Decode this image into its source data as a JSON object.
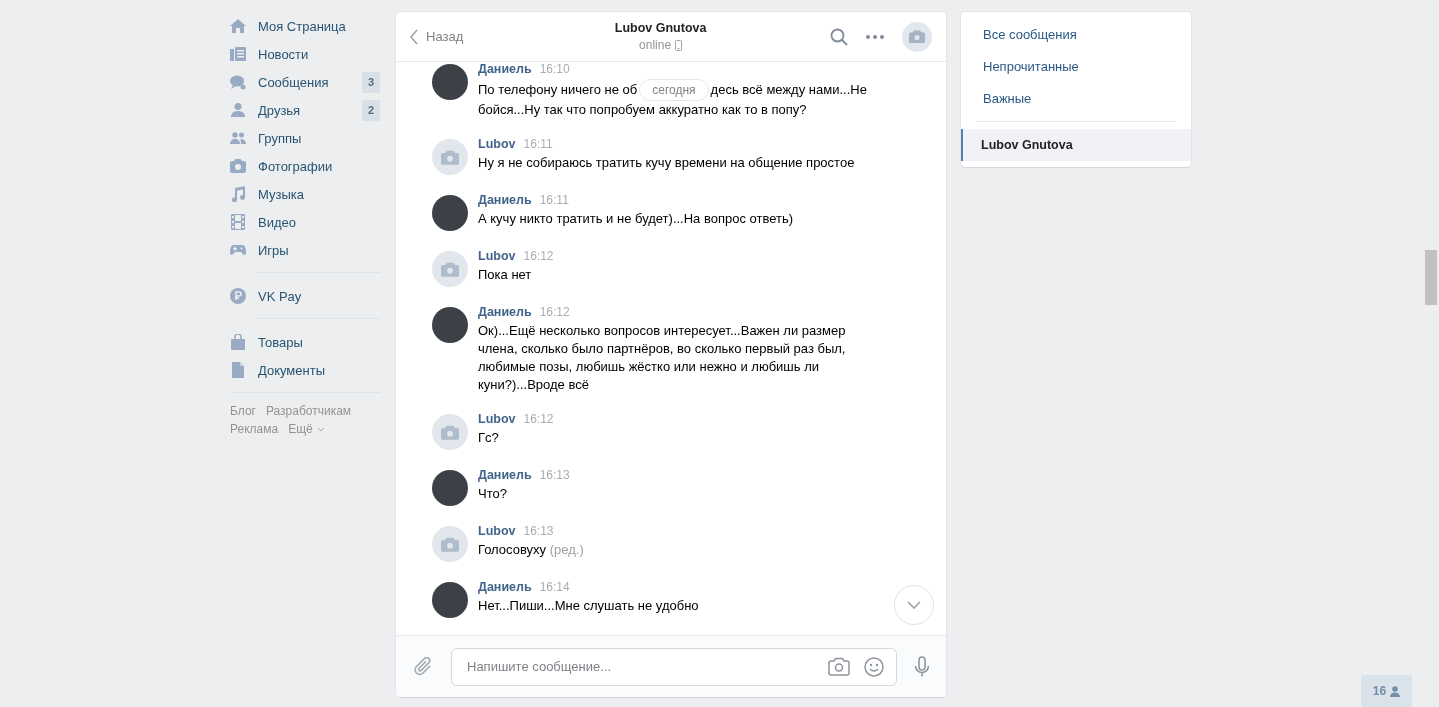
{
  "nav": {
    "sections": [
      [
        {
          "label": "Моя Страница",
          "kind": "home"
        },
        {
          "label": "Новости",
          "kind": "news"
        },
        {
          "label": "Сообщения",
          "kind": "messages",
          "badge": "3"
        },
        {
          "label": "Друзья",
          "kind": "person",
          "badge": "2"
        },
        {
          "label": "Группы",
          "kind": "people"
        },
        {
          "label": "Фотографии",
          "kind": "camera"
        },
        {
          "label": "Музыка",
          "kind": "music"
        },
        {
          "label": "Видео",
          "kind": "video"
        },
        {
          "label": "Игры",
          "kind": "games"
        }
      ],
      [
        {
          "label": "VK Pay",
          "kind": "pay"
        }
      ],
      [
        {
          "label": "Товары",
          "kind": "bag"
        },
        {
          "label": "Документы",
          "kind": "doc"
        }
      ]
    ],
    "footer_links": [
      "Блог",
      "Разработчикам",
      "Реклама",
      "Ещё"
    ]
  },
  "chat": {
    "header": {
      "back": "Назад",
      "title": "Lubov Gnutova",
      "status": "online"
    },
    "date_label": "сегодня",
    "messages": [
      {
        "author": "Даниель",
        "time": "16:10",
        "kind": "photo",
        "text_parts": [
          "По телефону ничего не об",
          "десь всё между нами...Не",
          "бойся...Ну так что попробуем аккуратно как то в попу?"
        ]
      },
      {
        "author": "Lubov",
        "time": "16:11",
        "kind": "placeholder",
        "text_parts": [
          "Ну я не собираюсь тратить кучу времени на общение простое"
        ]
      },
      {
        "author": "Даниель",
        "time": "16:11",
        "kind": "photo",
        "text_parts": [
          "А кучу никто тратить и не будет)...На вопрос ответь)"
        ]
      },
      {
        "author": "Lubov",
        "time": "16:12",
        "kind": "placeholder",
        "text_parts": [
          "Пока нет"
        ]
      },
      {
        "author": "Даниель",
        "time": "16:12",
        "kind": "photo",
        "text_parts": [
          "Ок)...Ещё несколько вопросов интересует...Важен ли размер члена, сколько было партнёров, во сколько первый раз был, любимые позы, любишь жёстко или нежно и любишь ли куни?)...Вроде всё"
        ]
      },
      {
        "author": "Lubov",
        "time": "16:12",
        "kind": "placeholder",
        "text_parts": [
          "Гс?"
        ]
      },
      {
        "author": "Даниель",
        "time": "16:13",
        "kind": "photo",
        "text_parts": [
          "Что?"
        ]
      },
      {
        "author": "Lubov",
        "time": "16:13",
        "kind": "placeholder",
        "text_parts": [
          "Голосовуху"
        ],
        "edited": "(ред.)"
      },
      {
        "author": "Даниель",
        "time": "16:14",
        "kind": "photo",
        "text_parts": [
          "Нет...Пиши...Мне слушать не удобно"
        ]
      }
    ],
    "composer": {
      "placeholder": "Напишите сообщение..."
    }
  },
  "right_menu": {
    "filters": [
      {
        "label": "Все сообщения",
        "selected": false
      },
      {
        "label": "Непрочитанные",
        "selected": false
      },
      {
        "label": "Важные",
        "selected": false
      }
    ],
    "conversations": [
      {
        "label": "Lubov Gnutova",
        "selected": true
      }
    ]
  },
  "online_count": "16"
}
